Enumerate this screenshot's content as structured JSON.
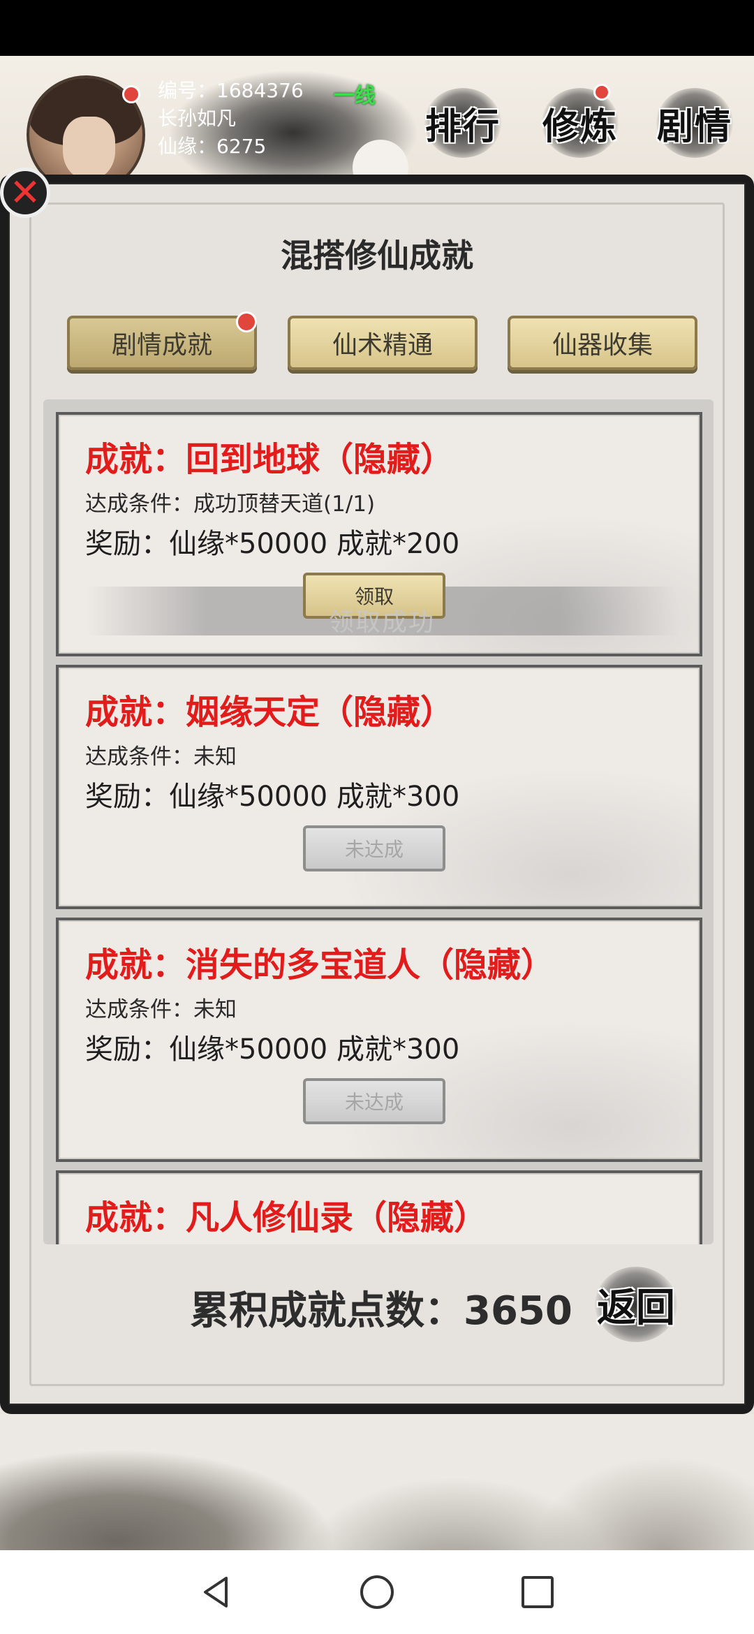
{
  "header": {
    "player_id": "编号：1684376",
    "player_name": "长孙如凡",
    "xianyuan": "仙缘：6275",
    "line": "一线",
    "nav": [
      {
        "label": "排行"
      },
      {
        "label": "修炼"
      },
      {
        "label": "剧情"
      }
    ]
  },
  "panel": {
    "title": "混搭修仙成就",
    "tabs": [
      {
        "label": "剧情成就"
      },
      {
        "label": "仙术精通"
      },
      {
        "label": "仙器收集"
      }
    ]
  },
  "achievements": [
    {
      "title": "成就：回到地球（隐藏）",
      "condition": "达成条件：成功顶替天道(1/1)",
      "reward": "奖励：仙缘*50000 成就*200",
      "button": "领取",
      "status_text": "领取成功"
    },
    {
      "title": "成就：姻缘天定（隐藏）",
      "condition": "达成条件：未知",
      "reward": "奖励：仙缘*50000 成就*300",
      "button": "未达成"
    },
    {
      "title": "成就：消失的多宝道人（隐藏）",
      "condition": "达成条件：未知",
      "reward": "奖励：仙缘*50000 成就*300",
      "button": "未达成"
    },
    {
      "title": "成就：凡人修仙录（隐藏）"
    }
  ],
  "footer": {
    "total": "累积成就点数：3650",
    "back": "返回"
  }
}
